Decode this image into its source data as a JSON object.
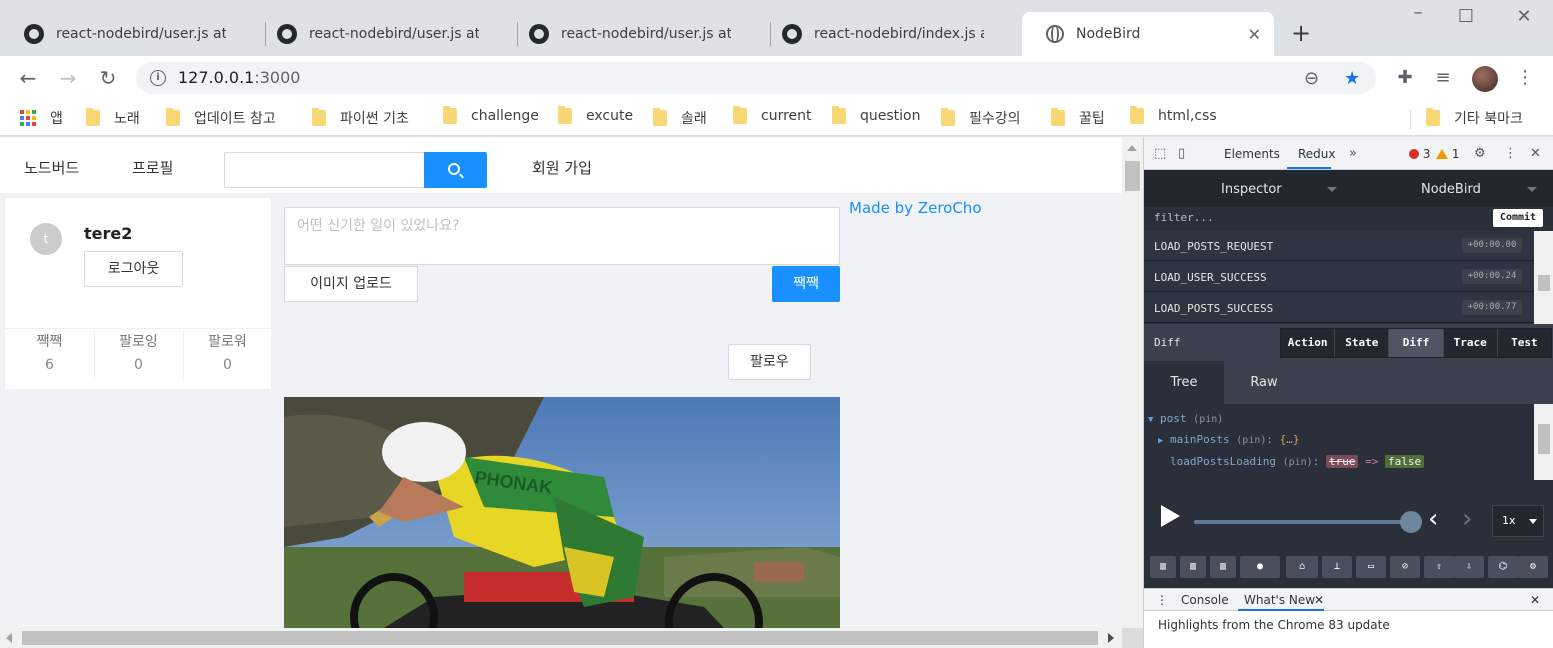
{
  "browser": {
    "tabs": [
      {
        "title": "react-nodebird/user.js at",
        "icon": "github-icon"
      },
      {
        "title": "react-nodebird/user.js at",
        "icon": "github-icon"
      },
      {
        "title": "react-nodebird/user.js at",
        "icon": "github-icon"
      },
      {
        "title": "react-nodebird/index.js a",
        "icon": "github-icon"
      },
      {
        "title": "NodeBird",
        "icon": "globe-icon",
        "active": true
      }
    ],
    "url_host": "127.0.0.1",
    "url_port": ":3000",
    "bookmarks": [
      "앱",
      "노래",
      "업데이트 참고",
      "파이썬 기초",
      "challenge",
      "excute",
      "솔래",
      "current",
      "question",
      "필수강의",
      "꿀팁",
      "html,css"
    ],
    "other_bookmarks": "기타 북마크"
  },
  "app": {
    "menu": {
      "home": "노드버드",
      "profile": "프로필",
      "signup": "회원 가입"
    },
    "user": {
      "avatar_letter": "t",
      "nickname": "tere2",
      "logout_label": "로그아웃",
      "stats": [
        {
          "label": "짹짹",
          "value": "6"
        },
        {
          "label": "팔로잉",
          "value": "0"
        },
        {
          "label": "팔로워",
          "value": "0"
        }
      ]
    },
    "post_form": {
      "placeholder": "어떤 신기한 일이 있었나요?",
      "upload_label": "이미지 업로드",
      "submit_label": "짹짹"
    },
    "made_by": "Made by ZeroCho",
    "follow_label": "팔로우",
    "colors": {
      "primary": "#1890ff",
      "background": "#f0f2f5"
    }
  },
  "devtools": {
    "tabs": [
      "Elements",
      "Redux"
    ],
    "errors": "3",
    "warnings": "1",
    "redux": {
      "inspector_label": "Inspector",
      "instance_label": "NodeBird",
      "filter_placeholder": "filter...",
      "commit_label": "Commit",
      "actions": [
        {
          "name": "LOAD_POSTS_REQUEST",
          "time": "+00:00.00"
        },
        {
          "name": "LOAD_USER_SUCCESS",
          "time": "+00:00.24"
        },
        {
          "name": "LOAD_POSTS_SUCCESS",
          "time": "+00:00.77"
        }
      ],
      "diff_label": "Diff",
      "monitor_tabs": [
        "Action",
        "State",
        "Diff",
        "Trace",
        "Test"
      ],
      "active_monitor": "Diff",
      "view_tabs": [
        "Tree",
        "Raw"
      ],
      "tree": {
        "root_key": "post",
        "pin": "(pin)",
        "child_key": "mainPosts",
        "child_value": "{…}",
        "changed_key": "loadPostsLoading",
        "old_value": "true",
        "arrow": "=>",
        "new_value": "false"
      },
      "speed": "1x"
    },
    "drawer": {
      "tabs": [
        "Console",
        "What's New"
      ],
      "message": "Highlights from the Chrome 83 update"
    }
  }
}
